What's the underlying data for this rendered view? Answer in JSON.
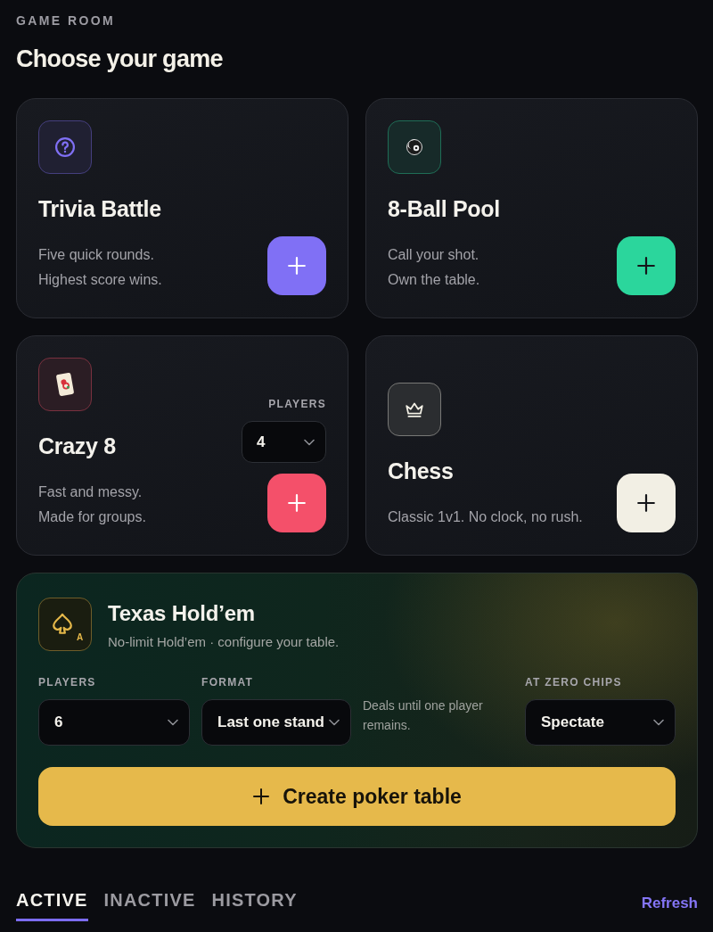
{
  "header": {
    "eyebrow": "GAME ROOM",
    "title": "Choose your game"
  },
  "games": [
    {
      "kind": "trivia",
      "color": "#8070f5",
      "title": "Trivia Battle",
      "description": [
        "Five quick rounds.",
        "Highest score wins."
      ]
    },
    {
      "kind": "pool",
      "color": "#2bd69c",
      "title": "8-Ball Pool",
      "description": [
        "Call your shot.",
        "Own the table."
      ]
    },
    {
      "kind": "cards",
      "color": "#f4506a",
      "title": "Crazy 8",
      "description": [
        "Fast and messy.",
        "Made for groups."
      ],
      "players": {
        "label": "PLAYERS",
        "value": "4"
      }
    },
    {
      "kind": "chess",
      "color": "#f2efe4",
      "title": "Chess",
      "description": [
        "Classic 1v1. No clock, no rush."
      ]
    }
  ],
  "poker": {
    "icon_letter": "A",
    "title": "Texas Hold’em",
    "subtitle": "No-limit Hold’em · configure your table.",
    "fields": [
      {
        "label": "PLAYERS",
        "value": "6"
      },
      {
        "label": "FORMAT",
        "value": "Last one stand",
        "hint": "Deals until one player remains."
      },
      {
        "label": "AT ZERO CHIPS",
        "value": "Spectate"
      }
    ],
    "button": "Create poker table"
  },
  "tabs": [
    {
      "label": "ACTIVE",
      "selected": true
    },
    {
      "label": "INACTIVE",
      "selected": false
    },
    {
      "label": "HISTORY",
      "selected": false
    }
  ],
  "refresh": "Refresh"
}
